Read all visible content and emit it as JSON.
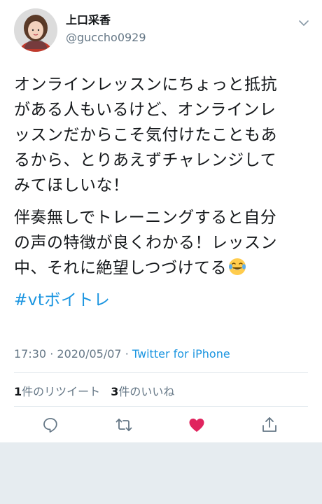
{
  "user": {
    "display_name": "上口采香",
    "handle": "@guccho0929"
  },
  "tweet": {
    "paragraph1": [
      "オンラインレッスンにちょっと抵抗",
      "がある人もいるけど、オンラインレ",
      "ッスンだからこそ気付けたこともあ",
      "るから、とりあえずチャレンジして",
      "みてほしいな！"
    ],
    "paragraph2": [
      "伴奏無しでトレーニングすると自分",
      "の声の特徴が良くわかる！レッスン",
      "中、それに絶望しつづけてる"
    ],
    "hashtag": "#vtボイトレ",
    "emoji": "face-with-tears-of-joy"
  },
  "meta": {
    "time": "17:30",
    "date": "2020/05/07",
    "separator": "·",
    "source": "Twitter for iPhone"
  },
  "stats": {
    "retweets_count": "1",
    "retweets_label": "件のリツイート",
    "likes_count": "3",
    "likes_label": "件のいいね"
  },
  "actions": [
    "reply-icon",
    "retweet-icon",
    "like-icon",
    "share-icon"
  ],
  "colors": {
    "link": "#1b95e0",
    "like": "#e0245e",
    "muted": "#657786",
    "text": "#14171a",
    "background": "#e6ecf0"
  }
}
